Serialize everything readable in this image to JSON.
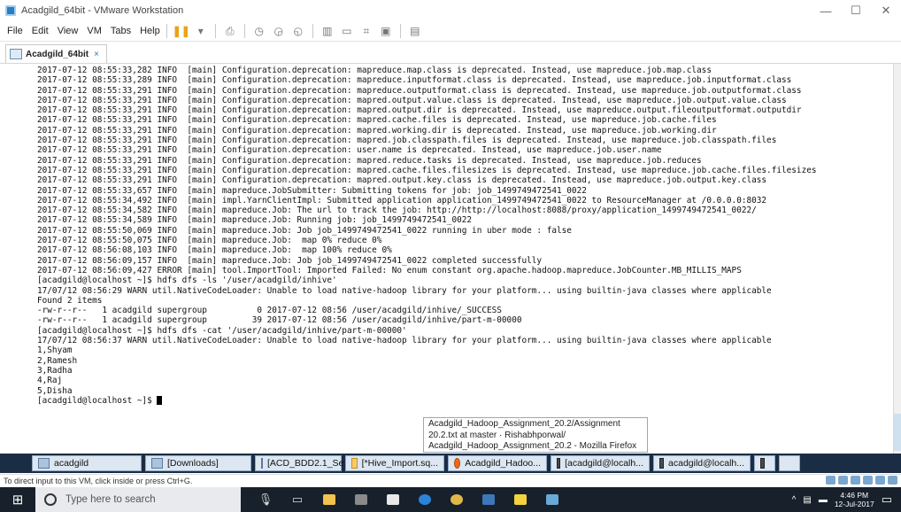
{
  "window": {
    "title": "Acadgild_64bit - VMware Workstation",
    "controls": [
      "—",
      "☐",
      "✕"
    ]
  },
  "menu": [
    "File",
    "Edit",
    "View",
    "VM",
    "Tabs",
    "Help"
  ],
  "tab": {
    "label": "Acadgild_64bit"
  },
  "terminal": {
    "lines": [
      "2017-07-12 08:55:33,282 INFO  [main] Configuration.deprecation: mapreduce.map.class is deprecated. Instead, use mapreduce.job.map.class",
      "2017-07-12 08:55:33,289 INFO  [main] Configuration.deprecation: mapreduce.inputformat.class is deprecated. Instead, use mapreduce.job.inputformat.class",
      "2017-07-12 08:55:33,291 INFO  [main] Configuration.deprecation: mapreduce.outputformat.class is deprecated. Instead, use mapreduce.job.outputformat.class",
      "2017-07-12 08:55:33,291 INFO  [main] Configuration.deprecation: mapred.output.value.class is deprecated. Instead, use mapreduce.job.output.value.class",
      "2017-07-12 08:55:33,291 INFO  [main] Configuration.deprecation: mapred.output.dir is deprecated. Instead, use mapreduce.output.fileoutputformat.outputdir",
      "2017-07-12 08:55:33,291 INFO  [main] Configuration.deprecation: mapred.cache.files is deprecated. Instead, use mapreduce.job.cache.files",
      "2017-07-12 08:55:33,291 INFO  [main] Configuration.deprecation: mapred.working.dir is deprecated. Instead, use mapreduce.job.working.dir",
      "2017-07-12 08:55:33,291 INFO  [main] Configuration.deprecation: mapred.job.classpath.files is deprecated. Instead, use mapreduce.job.classpath.files",
      "2017-07-12 08:55:33,291 INFO  [main] Configuration.deprecation: user.name is deprecated. Instead, use mapreduce.job.user.name",
      "2017-07-12 08:55:33,291 INFO  [main] Configuration.deprecation: mapred.reduce.tasks is deprecated. Instead, use mapreduce.job.reduces",
      "2017-07-12 08:55:33,291 INFO  [main] Configuration.deprecation: mapred.cache.files.filesizes is deprecated. Instead, use mapreduce.job.cache.files.filesizes",
      "2017-07-12 08:55:33,291 INFO  [main] Configuration.deprecation: mapred.output.key.class is deprecated. Instead, use mapreduce.job.output.key.class",
      "2017-07-12 08:55:33,657 INFO  [main] mapreduce.JobSubmitter: Submitting tokens for job: job_1499749472541_0022",
      "2017-07-12 08:55:34,492 INFO  [main] impl.YarnClientImpl: Submitted application application_1499749472541_0022 to ResourceManager at /0.0.0.0:8032",
      "2017-07-12 08:55:34,582 INFO  [main] mapreduce.Job: The url to track the job: http://http://localhost:8088/proxy/application_1499749472541_0022/",
      "2017-07-12 08:55:34,589 INFO  [main] mapreduce.Job: Running job: job_1499749472541_0022",
      "2017-07-12 08:55:50,069 INFO  [main] mapreduce.Job: Job job_1499749472541_0022 running in uber mode : false",
      "2017-07-12 08:55:50,075 INFO  [main] mapreduce.Job:  map 0% reduce 0%",
      "2017-07-12 08:56:08,103 INFO  [main] mapreduce.Job:  map 100% reduce 0%",
      "2017-07-12 08:56:09,157 INFO  [main] mapreduce.Job: Job job_1499749472541_0022 completed successfully",
      "2017-07-12 08:56:09,427 ERROR [main] tool.ImportTool: Imported Failed: No enum constant org.apache.hadoop.mapreduce.JobCounter.MB_MILLIS_MAPS",
      "[acadgild@localhost ~]$ hdfs dfs -ls '/user/acadgild/inhive'",
      "17/07/12 08:56:29 WARN util.NativeCodeLoader: Unable to load native-hadoop library for your platform... using builtin-java classes where applicable",
      "Found 2 items",
      "-rw-r--r--   1 acadgild supergroup          0 2017-07-12 08:56 /user/acadgild/inhive/_SUCCESS",
      "-rw-r--r--   1 acadgild supergroup         39 2017-07-12 08:56 /user/acadgild/inhive/part-m-00000",
      "[acadgild@localhost ~]$ hdfs dfs -cat '/user/acadgild/inhive/part-m-00000'",
      "17/07/12 08:56:37 WARN util.NativeCodeLoader: Unable to load native-hadoop library for your platform... using builtin-java classes where applicable",
      "1,Shyam",
      "2,Ramesh",
      "3,Radha",
      "4,Raj",
      "5,Disha"
    ],
    "prompt": "[acadgild@localhost ~]$ "
  },
  "tooltip": {
    "line1": "Acadgild_Hadoop_Assignment_20.2/Assignment",
    "line2": "20.2.txt at master · Rishabhporwal/",
    "line3": "Acadgild_Hadoop_Assignment_20.2 - Mozilla Firefox"
  },
  "guest_taskbar": [
    {
      "label": "acadgild",
      "icon": "folder-icon"
    },
    {
      "label": "[Downloads]",
      "icon": "folder-icon"
    },
    {
      "label": "[ACD_BDD2.1_Se...",
      "icon": "folder-icon"
    },
    {
      "label": "[*Hive_Import.sq...",
      "icon": "editor-icon"
    },
    {
      "label": "Acadgild_Hadoo...",
      "icon": "firefox-icon"
    },
    {
      "label": "[acadgild@localh...",
      "icon": "terminal-icon"
    },
    {
      "label": "acadgild@localh...",
      "icon": "terminal-icon"
    }
  ],
  "statusbar": {
    "text": "To direct input to this VM, click inside or press Ctrl+G."
  },
  "host_taskbar": {
    "search_placeholder": "Type here to search",
    "time": "4:46 PM",
    "date": "12-Jul-2017"
  }
}
